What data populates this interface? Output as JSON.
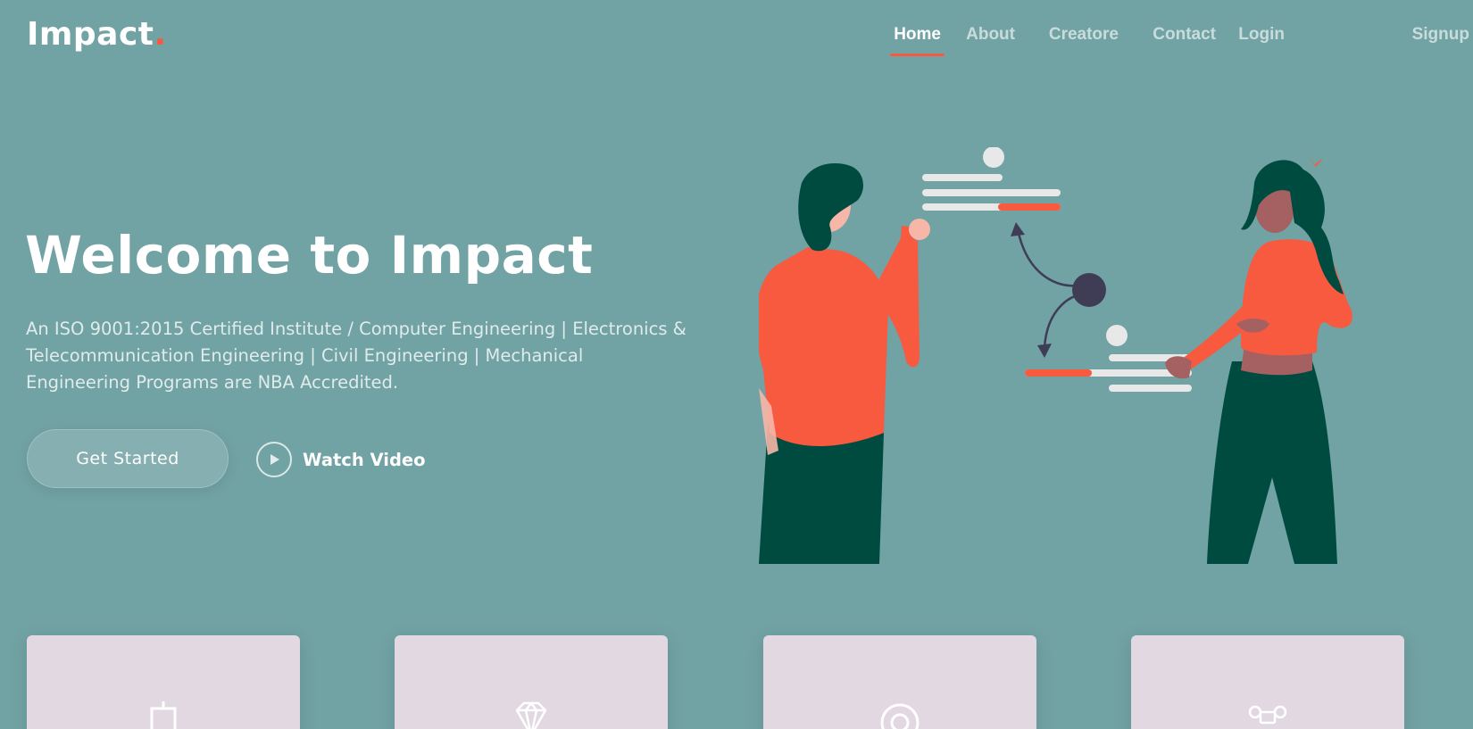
{
  "header": {
    "logo_text": "Impact",
    "logo_dot": ".",
    "nav": [
      {
        "label": "Home",
        "active": true
      },
      {
        "label": "About"
      },
      {
        "label": "Creatore"
      },
      {
        "label": "Contact"
      },
      {
        "label": "Login"
      },
      {
        "label": "Signup"
      }
    ]
  },
  "hero": {
    "title": "Welcome to Impact",
    "subtitle": "An ISO 9001:2015 Certified Institute / Computer Engineering | Electronics & Telecommunication Engineering | Civil Engineering | Mechanical Engineering Programs are NBA Accredited.",
    "get_started_label": "Get Started",
    "watch_video_label": "Watch Video",
    "illustration_icon": "team-collaboration-illustration"
  },
  "cards": [
    {
      "icon": "easel-icon"
    },
    {
      "icon": "gem-icon"
    },
    {
      "icon": "target-icon"
    },
    {
      "icon": "command-icon"
    }
  ],
  "colors": {
    "background": "#71a2a4",
    "accent": "#f85a40",
    "dark_green": "#004b40",
    "card": "#e2d8e2"
  }
}
